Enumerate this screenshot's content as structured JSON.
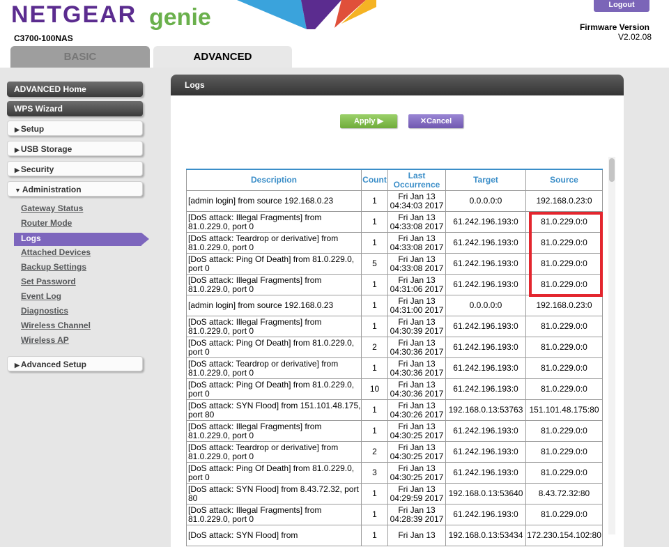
{
  "header": {
    "brand_netgear": "NETGEAR",
    "brand_genie": "genie",
    "model": "C3700-100NAS",
    "firmware_label": "Firmware Version",
    "firmware_value": "V2.02.08",
    "logout_label": "Logout"
  },
  "tabs": [
    {
      "label": "BASIC"
    },
    {
      "label": "ADVANCED"
    }
  ],
  "sidebar": {
    "buttons": [
      {
        "label": "ADVANCED Home"
      },
      {
        "label": "WPS Wizard"
      },
      {
        "label": "Setup"
      },
      {
        "label": "USB Storage"
      },
      {
        "label": "Security"
      },
      {
        "label": "Administration"
      }
    ],
    "sublinks": [
      {
        "label": "Gateway Status"
      },
      {
        "label": "Router Mode"
      },
      {
        "label": "Logs"
      },
      {
        "label": "Attached Devices"
      },
      {
        "label": "Backup Settings"
      },
      {
        "label": "Set Password"
      },
      {
        "label": "Event Log"
      },
      {
        "label": "Diagnostics"
      },
      {
        "label": "Wireless Channel"
      },
      {
        "label": "Wireless AP"
      }
    ],
    "advanced_setup": "Advanced Setup"
  },
  "panel": {
    "title": "Logs",
    "apply_label": "Apply",
    "cancel_label": "Cancel"
  },
  "table": {
    "headers": [
      "Description",
      "Count",
      "Last Occurrence",
      "Target",
      "Source"
    ],
    "rows": [
      {
        "desc": "[admin login] from source 192.168.0.23",
        "count": "1",
        "date": "Fri Jan 13",
        "time": "04:34:03 2017",
        "target": "0.0.0.0:0",
        "source": "192.168.0.23:0"
      },
      {
        "desc": "[DoS attack: Illegal Fragments] from 81.0.229.0, port 0",
        "count": "1",
        "date": "Fri Jan 13",
        "time": "04:33:08 2017",
        "target": "61.242.196.193:0",
        "source": "81.0.229.0:0"
      },
      {
        "desc": "[DoS attack: Teardrop or derivative] from 81.0.229.0, port 0",
        "count": "1",
        "date": "Fri Jan 13",
        "time": "04:33:08 2017",
        "target": "61.242.196.193:0",
        "source": "81.0.229.0:0"
      },
      {
        "desc": "[DoS attack: Ping Of Death] from 81.0.229.0, port 0",
        "count": "5",
        "date": "Fri Jan 13",
        "time": "04:33:08 2017",
        "target": "61.242.196.193:0",
        "source": "81.0.229.0:0"
      },
      {
        "desc": "[DoS attack: Illegal Fragments] from 81.0.229.0, port 0",
        "count": "1",
        "date": "Fri Jan 13",
        "time": "04:31:06 2017",
        "target": "61.242.196.193:0",
        "source": "81.0.229.0:0"
      },
      {
        "desc": "[admin login] from source 192.168.0.23",
        "count": "1",
        "date": "Fri Jan 13",
        "time": "04:31:00 2017",
        "target": "0.0.0.0:0",
        "source": "192.168.0.23:0"
      },
      {
        "desc": "[DoS attack: Illegal Fragments] from 81.0.229.0, port 0",
        "count": "1",
        "date": "Fri Jan 13",
        "time": "04:30:39 2017",
        "target": "61.242.196.193:0",
        "source": "81.0.229.0:0"
      },
      {
        "desc": "[DoS attack: Ping Of Death] from 81.0.229.0, port 0",
        "count": "2",
        "date": "Fri Jan 13",
        "time": "04:30:36 2017",
        "target": "61.242.196.193:0",
        "source": "81.0.229.0:0"
      },
      {
        "desc": "[DoS attack: Teardrop or derivative] from 81.0.229.0, port 0",
        "count": "1",
        "date": "Fri Jan 13",
        "time": "04:30:36 2017",
        "target": "61.242.196.193:0",
        "source": "81.0.229.0:0"
      },
      {
        "desc": "[DoS attack: Ping Of Death] from 81.0.229.0, port 0",
        "count": "10",
        "date": "Fri Jan 13",
        "time": "04:30:36 2017",
        "target": "61.242.196.193:0",
        "source": "81.0.229.0:0"
      },
      {
        "desc": "[DoS attack: SYN Flood] from 151.101.48.175, port 80",
        "count": "1",
        "date": "Fri Jan 13",
        "time": "04:30:26 2017",
        "target": "192.168.0.13:53763",
        "source": "151.101.48.175:80"
      },
      {
        "desc": "[DoS attack: Illegal Fragments] from 81.0.229.0, port 0",
        "count": "1",
        "date": "Fri Jan 13",
        "time": "04:30:25 2017",
        "target": "61.242.196.193:0",
        "source": "81.0.229.0:0"
      },
      {
        "desc": "[DoS attack: Teardrop or derivative] from 81.0.229.0, port 0",
        "count": "2",
        "date": "Fri Jan 13",
        "time": "04:30:25 2017",
        "target": "61.242.196.193:0",
        "source": "81.0.229.0:0"
      },
      {
        "desc": "[DoS attack: Ping Of Death] from 81.0.229.0, port 0",
        "count": "3",
        "date": "Fri Jan 13",
        "time": "04:30:25 2017",
        "target": "61.242.196.193:0",
        "source": "81.0.229.0:0"
      },
      {
        "desc": "[DoS attack: SYN Flood] from 8.43.72.32, port 80",
        "count": "1",
        "date": "Fri Jan 13",
        "time": "04:29:59 2017",
        "target": "192.168.0.13:53640",
        "source": "8.43.72.32:80"
      },
      {
        "desc": "[DoS attack: Illegal Fragments] from 81.0.229.0, port 0",
        "count": "1",
        "date": "Fri Jan 13",
        "time": "04:28:39 2017",
        "target": "61.242.196.193:0",
        "source": "81.0.229.0:0"
      },
      {
        "desc": "[DoS attack: SYN Flood] from",
        "count": "1",
        "date": "Fri Jan 13",
        "time": "",
        "target": "192.168.0.13:53434",
        "source": "172.230.154.102:80"
      }
    ]
  },
  "colors": {
    "brand_purple": "#5b2c8f",
    "brand_green": "#6ab04c",
    "header_link_blue": "#3b8ec8",
    "highlight_red": "#e3262e",
    "active_nav_purple": "#7d66bd"
  }
}
